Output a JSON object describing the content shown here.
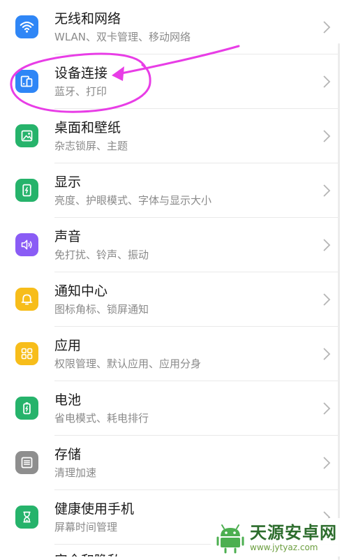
{
  "settings": {
    "items": [
      {
        "title": "无线和网络",
        "subtitle": "WLAN、双卡管理、移动网络",
        "icon": "wifi-icon",
        "color": "#2f86f6"
      },
      {
        "title": "设备连接",
        "subtitle": "蓝牙、打印",
        "icon": "device-connection-icon",
        "color": "#2f86f6"
      },
      {
        "title": "桌面和壁纸",
        "subtitle": "杂志锁屏、主题",
        "icon": "wallpaper-icon",
        "color": "#26b36b"
      },
      {
        "title": "显示",
        "subtitle": "亮度、护眼模式、字体与显示大小",
        "icon": "display-icon",
        "color": "#26b36b"
      },
      {
        "title": "声音",
        "subtitle": "免打扰、铃声、振动",
        "icon": "sound-icon",
        "color": "#8a5cf5"
      },
      {
        "title": "通知中心",
        "subtitle": "图标角标、锁屏通知",
        "icon": "notification-bell-icon",
        "color": "#f7bd1a"
      },
      {
        "title": "应用",
        "subtitle": "权限管理、默认应用、应用分身",
        "icon": "apps-grid-icon",
        "color": "#f7bd1a"
      },
      {
        "title": "电池",
        "subtitle": "省电模式、耗电排行",
        "icon": "battery-icon",
        "color": "#26b36b"
      },
      {
        "title": "存储",
        "subtitle": "清理加速",
        "icon": "storage-icon",
        "color": "#8e8e8e"
      },
      {
        "title": "健康使用手机",
        "subtitle": "屏幕时间管理",
        "icon": "hourglass-icon",
        "color": "#26b36b"
      }
    ],
    "next_partial_title": "安全和隐私"
  },
  "annotation": {
    "color": "#e83de6"
  },
  "watermark": {
    "name": "天源安卓网",
    "url": "www.jytyaz.com"
  }
}
